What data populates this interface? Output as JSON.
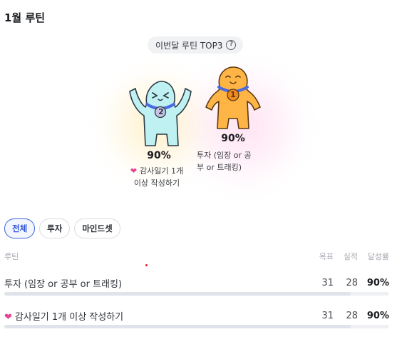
{
  "section": {
    "title": "1월 루틴"
  },
  "top3": {
    "label": "이번달 루틴 TOP3",
    "help_icon": "question-circle-icon",
    "first": {
      "rank": "1",
      "percent": "90%",
      "name_line1": "투자 (임장 or 공",
      "name_line2": "부 or 트래킹)"
    },
    "second": {
      "rank": "2",
      "percent": "90%",
      "name_line1": "감사일기 1개",
      "name_line2": "이상 작성하기",
      "heart": "heart-icon"
    }
  },
  "tabs": [
    {
      "label": "전체",
      "active": true
    },
    {
      "label": "투자",
      "active": false
    },
    {
      "label": "마인드셋",
      "active": false
    }
  ],
  "table": {
    "headers": {
      "routine": "루틴",
      "goal": "목표",
      "actual": "실적",
      "rate": "달성률"
    },
    "rows": [
      {
        "name": "투자 (임장 or 공부 or 트래킹)",
        "goal": "31",
        "actual": "28",
        "rate": "90%",
        "progress": 0.9
      },
      {
        "name": "감사일기 1개 이상 작성하기",
        "goal": "31",
        "actual": "28",
        "rate": "90%",
        "progress": 0.9,
        "heart": "heart-icon"
      }
    ]
  },
  "colors": {
    "accent": "#3d63dd",
    "heart": "#e5448f",
    "mascot_blue": "#b9eef0",
    "mascot_orange": "#ffb24a",
    "medal_ribbon": "#4a6be0"
  }
}
